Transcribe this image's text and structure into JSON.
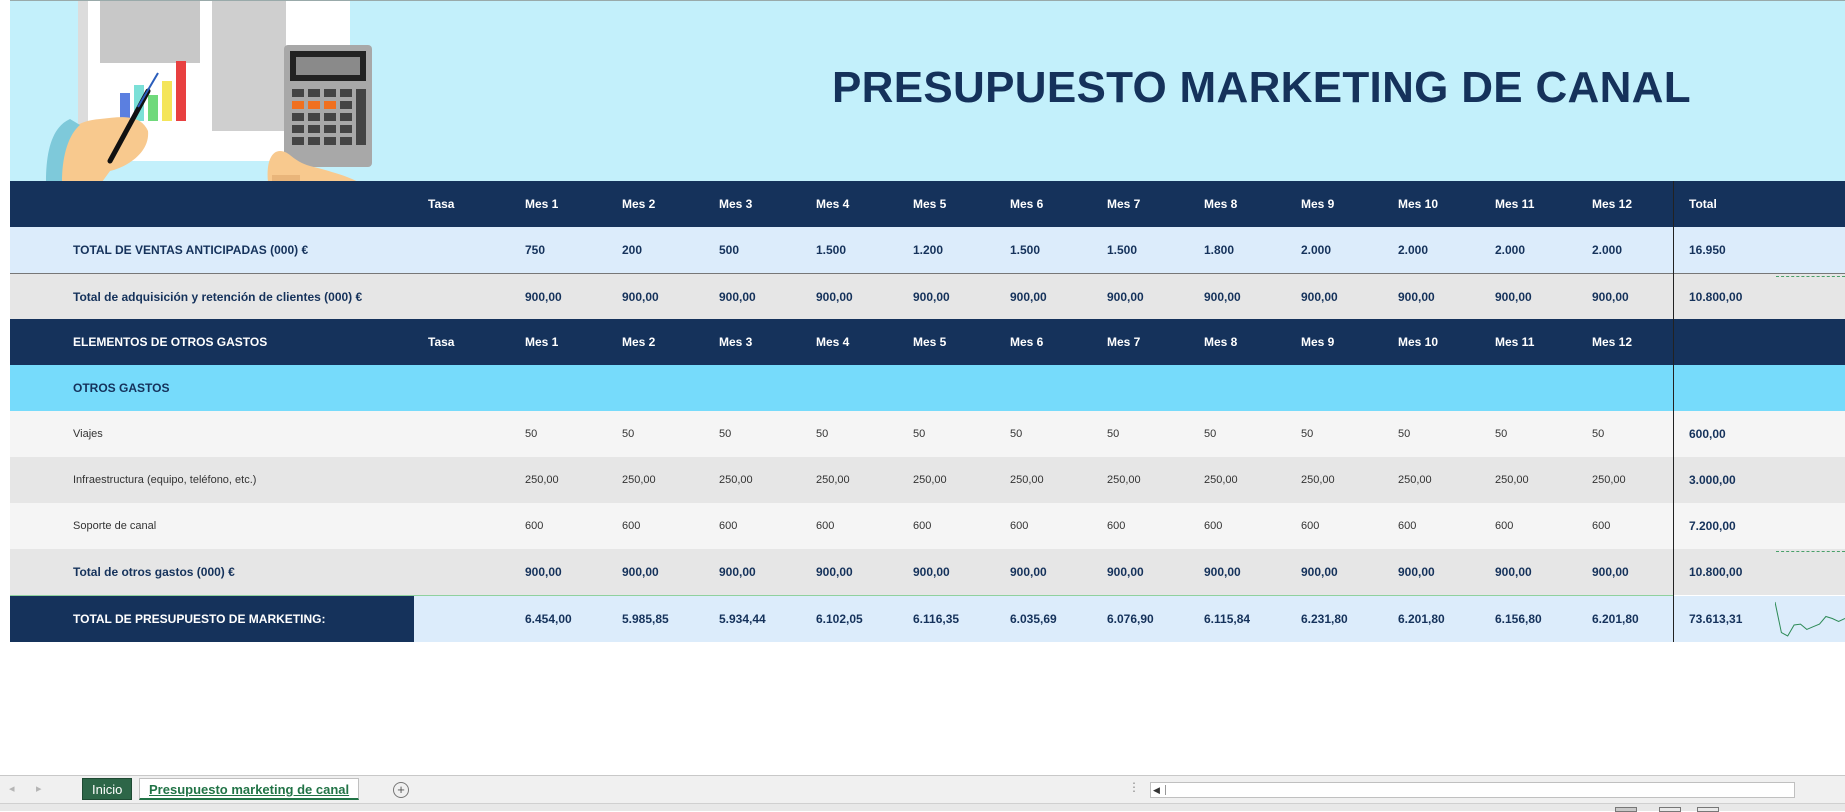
{
  "title": "PRESUPUESTO MARKETING DE CANAL",
  "columns": {
    "tasa": "Tasa",
    "months": [
      "Mes 1",
      "Mes 2",
      "Mes 3",
      "Mes 4",
      "Mes 5",
      "Mes 6",
      "Mes 7",
      "Mes 8",
      "Mes 9",
      "Mes 10",
      "Mes 11",
      "Mes 12"
    ],
    "total": "Total"
  },
  "sales": {
    "label": "TOTAL DE VENTAS ANTICIPADAS (000) €",
    "values": [
      "750",
      "200",
      "500",
      "1.500",
      "1.200",
      "1.500",
      "1.500",
      "1.800",
      "2.000",
      "2.000",
      "2.000",
      "2.000"
    ],
    "total": "16.950"
  },
  "acquisition": {
    "label": "Total de adquisición y retención de clientes (000) €",
    "values": [
      "900,00",
      "900,00",
      "900,00",
      "900,00",
      "900,00",
      "900,00",
      "900,00",
      "900,00",
      "900,00",
      "900,00",
      "900,00",
      "900,00"
    ],
    "total": "10.800,00"
  },
  "other_header": {
    "label": "ELEMENTOS DE OTROS GASTOS",
    "tasa": "Tasa",
    "months": [
      "Mes 1",
      "Mes 2",
      "Mes 3",
      "Mes 4",
      "Mes 5",
      "Mes 6",
      "Mes 7",
      "Mes 8",
      "Mes 9",
      "Mes 10",
      "Mes 11",
      "Mes 12"
    ]
  },
  "group": {
    "label": "OTROS GASTOS"
  },
  "items": [
    {
      "label": "Viajes",
      "values": [
        "50",
        "50",
        "50",
        "50",
        "50",
        "50",
        "50",
        "50",
        "50",
        "50",
        "50",
        "50"
      ],
      "total": "600,00"
    },
    {
      "label": "Infraestructura (equipo, teléfono, etc.)",
      "values": [
        "250,00",
        "250,00",
        "250,00",
        "250,00",
        "250,00",
        "250,00",
        "250,00",
        "250,00",
        "250,00",
        "250,00",
        "250,00",
        "250,00"
      ],
      "total": "3.000,00"
    },
    {
      "label": "Soporte de canal",
      "values": [
        "600",
        "600",
        "600",
        "600",
        "600",
        "600",
        "600",
        "600",
        "600",
        "600",
        "600",
        "600"
      ],
      "total": "7.200,00"
    }
  ],
  "other_total": {
    "label": "Total de otros gastos (000) €",
    "values": [
      "900,00",
      "900,00",
      "900,00",
      "900,00",
      "900,00",
      "900,00",
      "900,00",
      "900,00",
      "900,00",
      "900,00",
      "900,00",
      "900,00"
    ],
    "total": "10.800,00"
  },
  "grand_total": {
    "label": "TOTAL DE PRESUPUESTO DE MARKETING:",
    "values": [
      "6.454,00",
      "5.985,85",
      "5.934,44",
      "6.102,05",
      "6.116,35",
      "6.035,69",
      "6.076,90",
      "6.115,84",
      "6.231,80",
      "6.201,80",
      "6.156,80",
      "6.201,80"
    ],
    "total": "73.613,31",
    "sparkline": [
      6454.0,
      5985.85,
      5934.44,
      6102.05,
      6116.35,
      6035.69,
      6076.9,
      6115.84,
      6231.8,
      6201.8,
      6156.8,
      6201.8
    ]
  },
  "sheet_tabs": [
    "Inicio",
    "Presupuesto marketing de canal"
  ],
  "active_tab": "Presupuesto marketing de canal",
  "icons": {
    "prev_sheet": "triangle-left-icon",
    "next_sheet": "triangle-right-icon",
    "add_sheet": "plus-circle-icon",
    "scroll_left": "triangle-left-icon"
  },
  "colors": {
    "banner": "#c3f0fb",
    "navy": "#15325b",
    "sky": "#76dbfb",
    "light_blue": "#dcecfb",
    "gray": "#e6e6e6",
    "sheet_tab_green": "#217346"
  }
}
